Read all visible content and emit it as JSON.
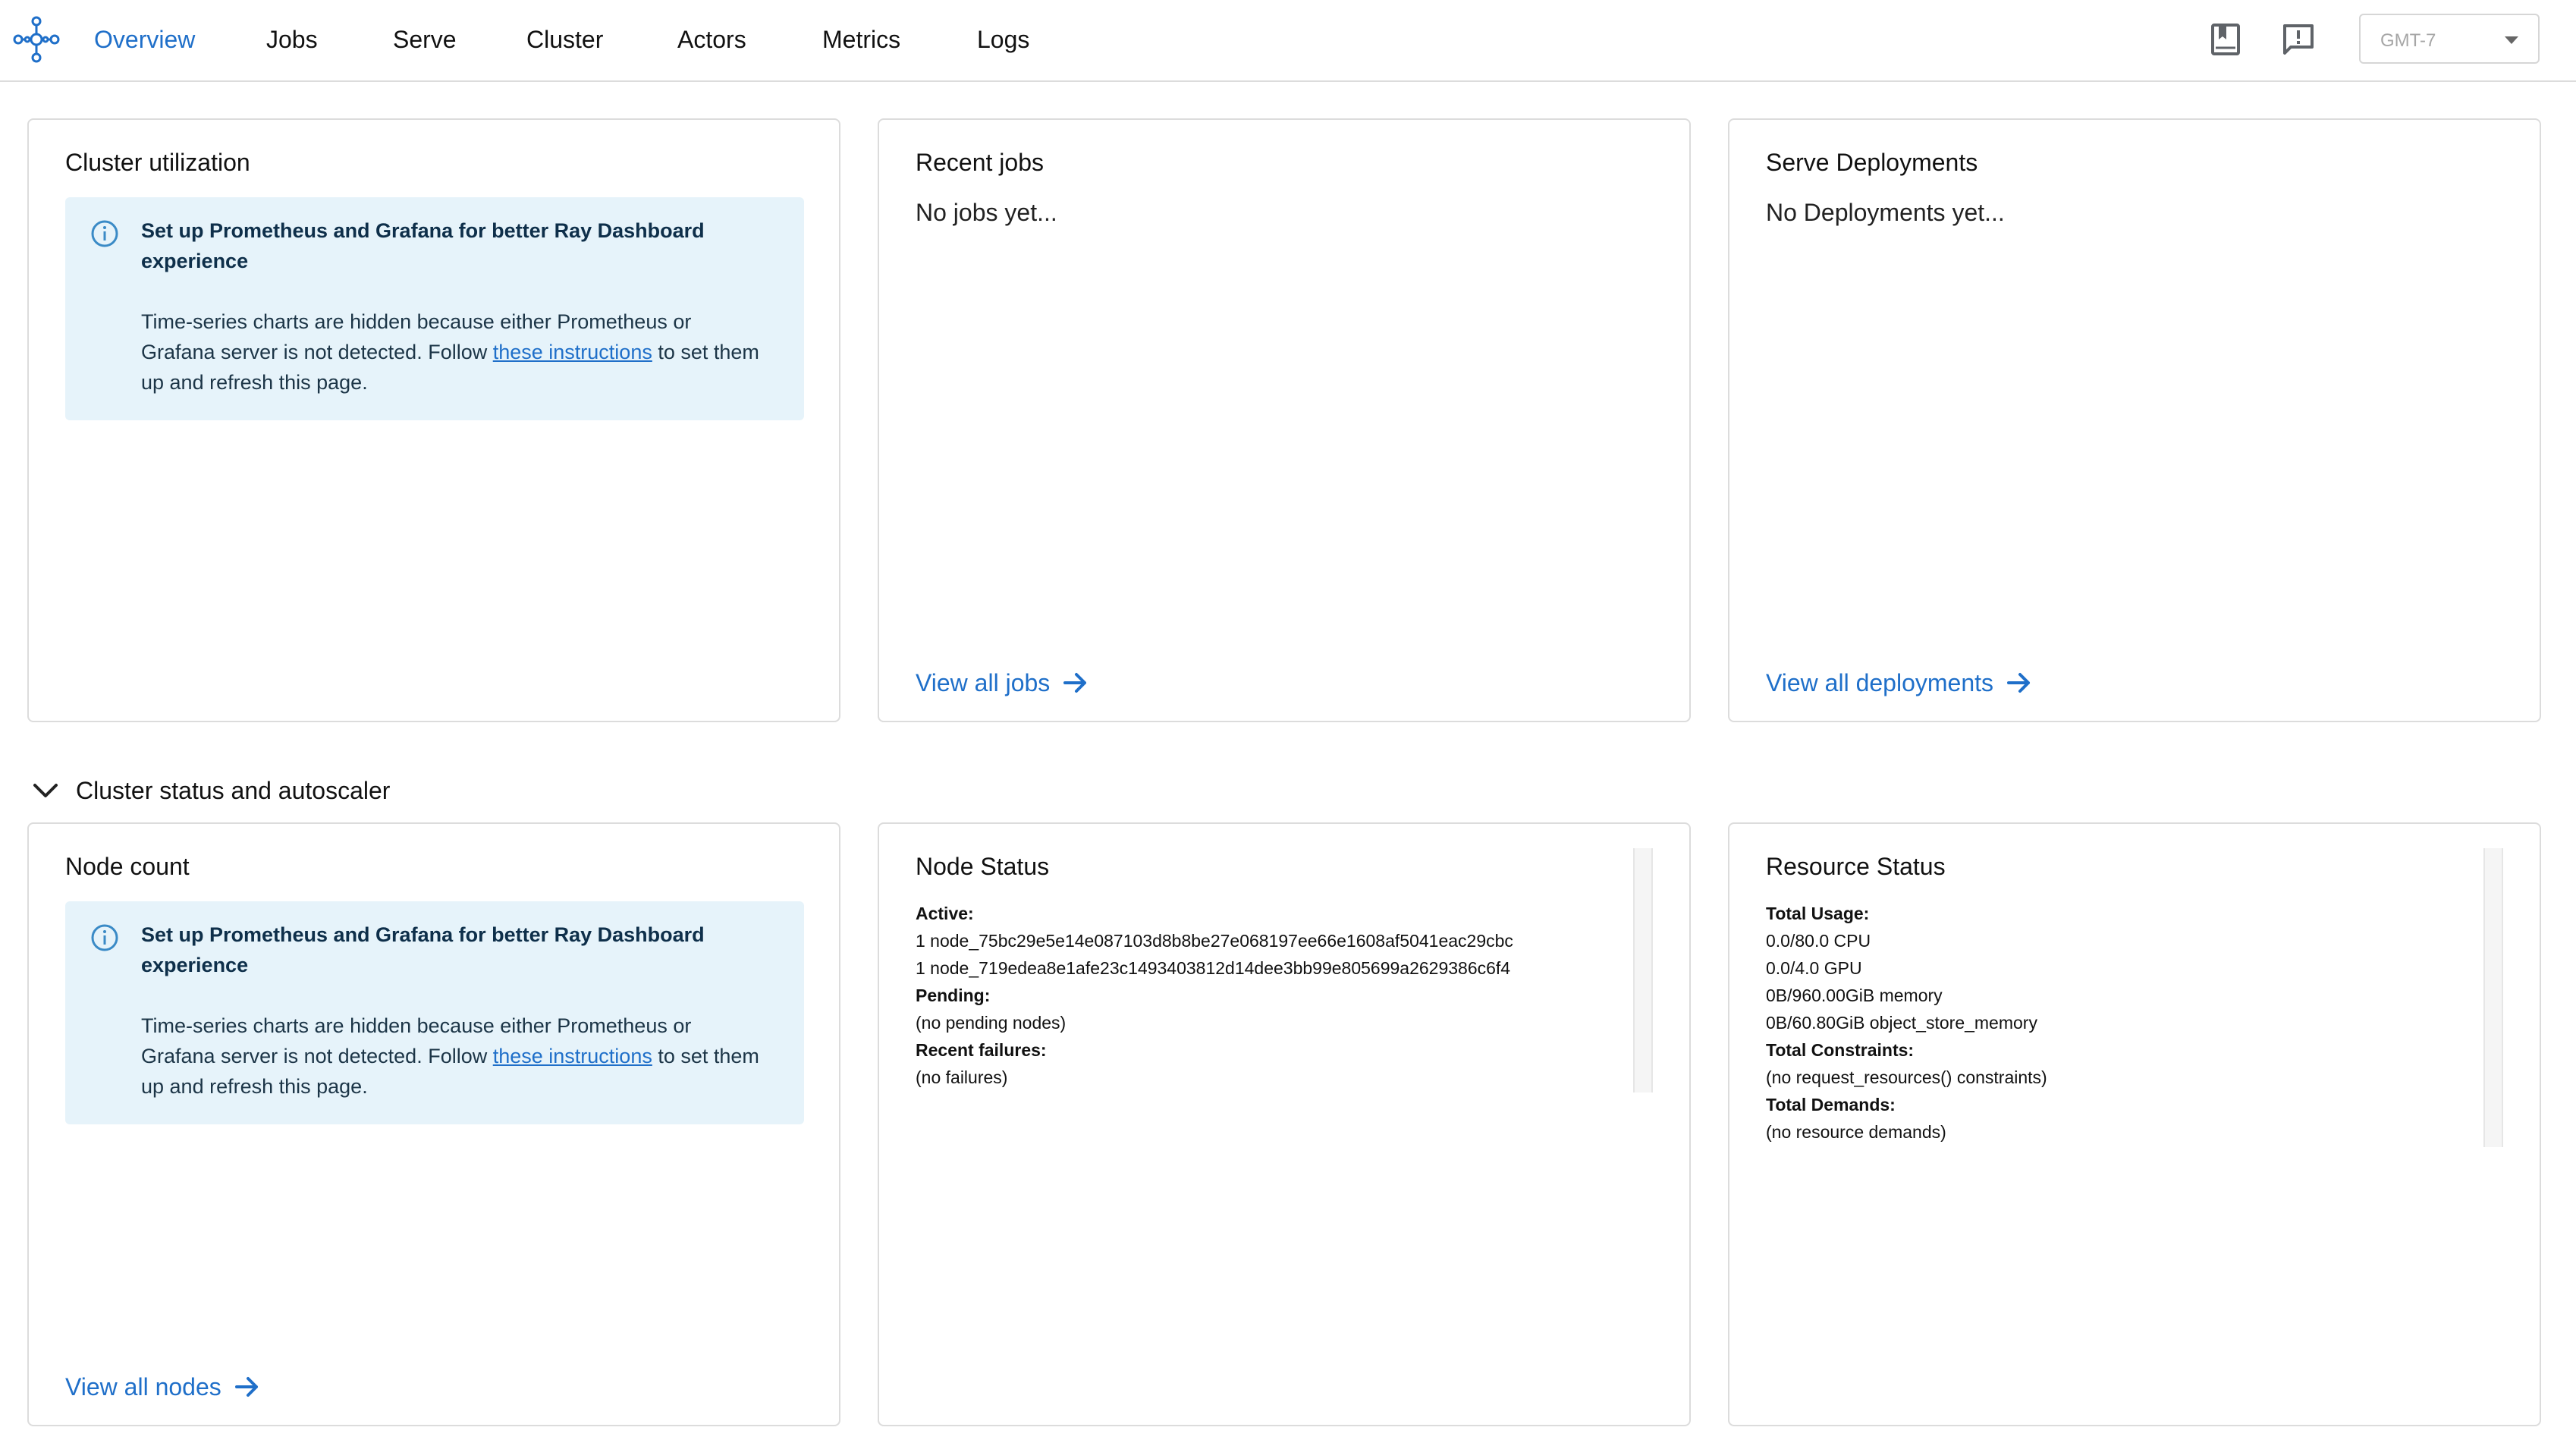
{
  "nav": {
    "logo_icon": "ray-logo-icon",
    "tabs": [
      "Overview",
      "Jobs",
      "Serve",
      "Cluster",
      "Actors",
      "Metrics",
      "Logs"
    ],
    "active_tab": "Overview",
    "icons": [
      "docs-icon",
      "feedback-icon"
    ],
    "timezone": {
      "value": "GMT-7",
      "icon": "caret-down-icon"
    }
  },
  "cluster_utilization": {
    "title": "Cluster utilization",
    "alert": {
      "icon": "info-icon",
      "title": "Set up Prometheus and Grafana for better Ray Dashboard experience",
      "body_before": "Time-series charts are hidden because either Prometheus or Grafana server is not detected. Follow ",
      "link": "these instructions",
      "body_after": " to set them up and refresh this page."
    }
  },
  "recent_jobs": {
    "title": "Recent jobs",
    "empty": "No jobs yet...",
    "view_all": "View all jobs"
  },
  "serve_deployments": {
    "title": "Serve Deployments",
    "empty": "No Deployments yet...",
    "view_all": "View all deployments"
  },
  "section": {
    "title": "Cluster status and autoscaler",
    "icon": "chevron-down-icon"
  },
  "node_count": {
    "title": "Node count",
    "alert": {
      "icon": "info-icon",
      "title": "Set up Prometheus and Grafana for better Ray Dashboard experience",
      "body_before": "Time-series charts are hidden because either Prometheus or Grafana server is not detected. Follow ",
      "link": "these instructions",
      "body_after": " to set them up and refresh this page."
    },
    "view_all": "View all nodes"
  },
  "node_status": {
    "title": "Node Status",
    "active_label": "Active:",
    "active_nodes": [
      "1 node_75bc29e5e14e087103d8b8be27e068197ee66e1608af5041eac29cbc",
      "1 node_719edea8e1afe23c1493403812d14dee3bb99e805699a2629386c6f4"
    ],
    "pending_label": "Pending:",
    "pending_value": "(no pending nodes)",
    "failures_label": "Recent failures:",
    "failures_value": "(no failures)"
  },
  "resource_status": {
    "title": "Resource Status",
    "usage_label": "Total Usage:",
    "usage": [
      "0.0/80.0 CPU",
      "0.0/4.0 GPU",
      "0B/960.00GiB memory",
      "0B/60.80GiB object_store_memory"
    ],
    "constraints_label": "Total Constraints:",
    "constraints_value": "(no request_resources() constraints)",
    "demands_label": "Total Demands:",
    "demands_value": "(no resource demands)"
  },
  "colors": {
    "accent": "#1f6fc9",
    "alert_bg": "#e6f3fa",
    "border": "#dcdcdc"
  }
}
